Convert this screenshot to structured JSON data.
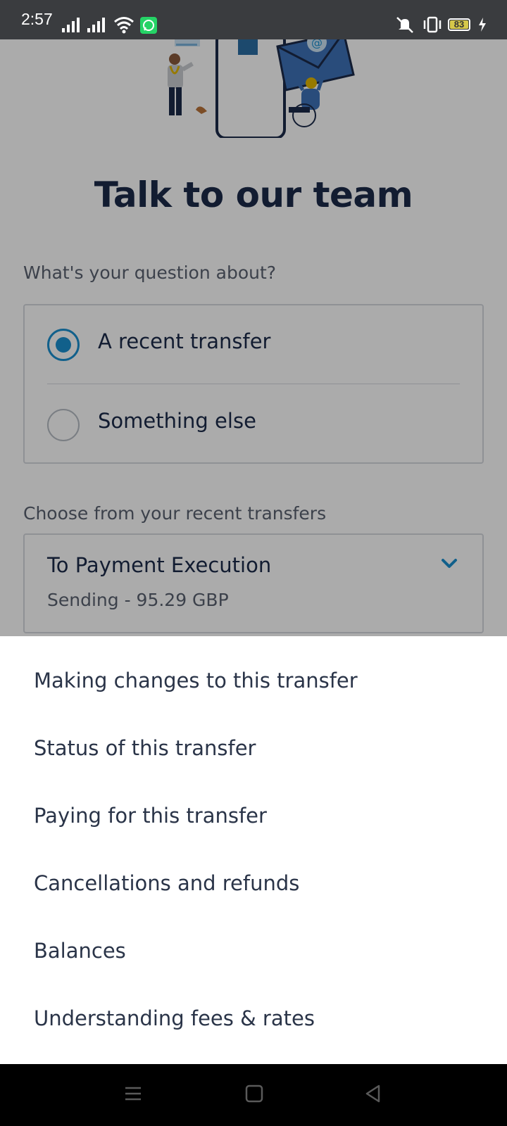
{
  "status_bar": {
    "time": "2:57",
    "battery": "83",
    "icons": [
      "signal-icon",
      "signal-icon",
      "wifi-icon",
      "whatsapp-icon",
      "mute-icon",
      "vibrate-icon",
      "battery-icon",
      "charging-icon"
    ]
  },
  "page": {
    "title": "Talk to our team",
    "question_label": "What's your question about?",
    "options": [
      {
        "label": "A recent transfer",
        "selected": true
      },
      {
        "label": "Something else",
        "selected": false
      }
    ],
    "transfers_label": "Choose from your recent transfers",
    "selected_transfer": {
      "title": "To Payment Execution",
      "subtitle": "Sending - 95.29 GBP"
    }
  },
  "sheet": {
    "items": [
      "Making changes to this transfer",
      "Status of this transfer",
      "Paying for this transfer",
      "Cancellations and refunds",
      "Balances",
      "Understanding fees & rates"
    ]
  },
  "nav": {
    "icons": [
      "menu-icon",
      "home-icon",
      "back-icon"
    ]
  },
  "colors": {
    "accent": "#1a8fd0",
    "title": "#1b2a4a",
    "overlay": "rgba(0,0,0,0.33)"
  }
}
